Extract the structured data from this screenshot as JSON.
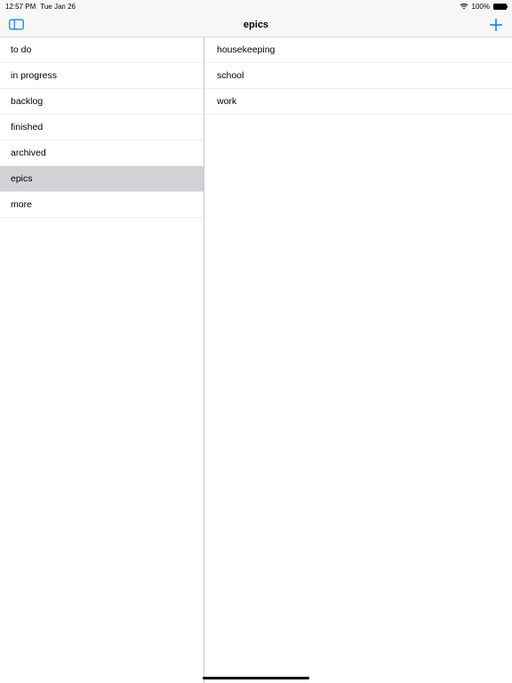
{
  "statusBar": {
    "time": "12:57 PM",
    "date": "Tue Jan 26",
    "batteryPercent": "100%"
  },
  "nav": {
    "title": "epics"
  },
  "sidebar": {
    "items": [
      {
        "label": "to do",
        "selected": false
      },
      {
        "label": "in progress",
        "selected": false
      },
      {
        "label": "backlog",
        "selected": false
      },
      {
        "label": "finished",
        "selected": false
      },
      {
        "label": "archived",
        "selected": false
      },
      {
        "label": "epics",
        "selected": true
      },
      {
        "label": "more",
        "selected": false
      }
    ]
  },
  "content": {
    "items": [
      {
        "label": "housekeeping"
      },
      {
        "label": "school"
      },
      {
        "label": "work"
      }
    ]
  }
}
